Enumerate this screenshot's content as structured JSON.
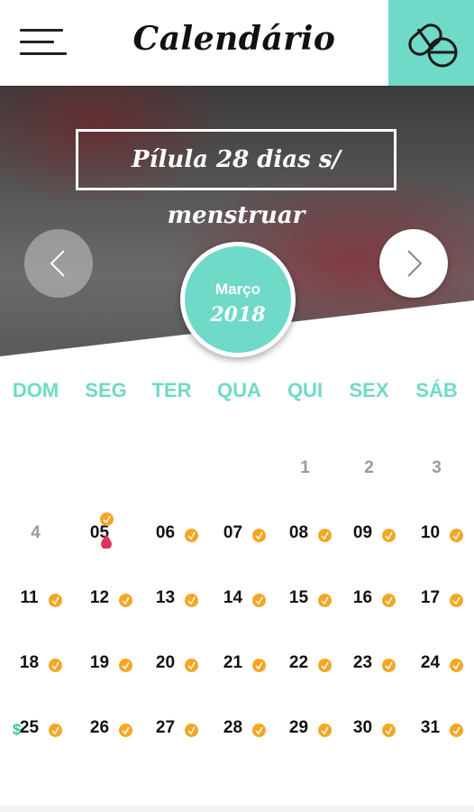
{
  "header": {
    "title": "Calendário",
    "menu_icon": "hamburger-menu-icon",
    "pill_icon": "pills-icon",
    "accent": "#6fdac7"
  },
  "hero": {
    "banner": "Pílula 28 dias s/ menstruar",
    "prev_icon": "chevron-left-icon",
    "next_icon": "chevron-right-icon"
  },
  "month": {
    "name": "Março",
    "year": "2018"
  },
  "weekdays": [
    "DOM",
    "SEG",
    "TER",
    "QUA",
    "QUI",
    "SEX",
    "SÁB"
  ],
  "weeks": [
    [
      {
        "d": ""
      },
      {
        "d": ""
      },
      {
        "d": ""
      },
      {
        "d": ""
      },
      {
        "d": "1",
        "other": true
      },
      {
        "d": "2",
        "other": true
      },
      {
        "d": "3",
        "other": true
      }
    ],
    [
      {
        "d": "4",
        "other": true
      },
      {
        "d": "05",
        "pill": true,
        "period": true
      },
      {
        "d": "06",
        "pill": true
      },
      {
        "d": "07",
        "pill": true
      },
      {
        "d": "08",
        "pill": true
      },
      {
        "d": "09",
        "pill": true
      },
      {
        "d": "10",
        "pill": true
      }
    ],
    [
      {
        "d": "11",
        "pill": true
      },
      {
        "d": "12",
        "pill": true
      },
      {
        "d": "13",
        "pill": true
      },
      {
        "d": "14",
        "pill": true
      },
      {
        "d": "15",
        "pill": true
      },
      {
        "d": "16",
        "pill": true
      },
      {
        "d": "17",
        "pill": true
      }
    ],
    [
      {
        "d": "18",
        "pill": true
      },
      {
        "d": "19",
        "pill": true
      },
      {
        "d": "20",
        "pill": true
      },
      {
        "d": "21",
        "pill": true
      },
      {
        "d": "22",
        "pill": true
      },
      {
        "d": "23",
        "pill": true
      },
      {
        "d": "24",
        "pill": true
      }
    ],
    [
      {
        "d": "25",
        "pill": true,
        "money": true
      },
      {
        "d": "26",
        "pill": true
      },
      {
        "d": "27",
        "pill": true
      },
      {
        "d": "28",
        "pill": true
      },
      {
        "d": "29",
        "pill": true
      },
      {
        "d": "30",
        "pill": true
      },
      {
        "d": "31",
        "pill": true
      }
    ]
  ],
  "markers": {
    "pill_color": "#f5a623",
    "period_color": "#e0335a",
    "money_color": "#39c690",
    "money_symbol": "$"
  }
}
